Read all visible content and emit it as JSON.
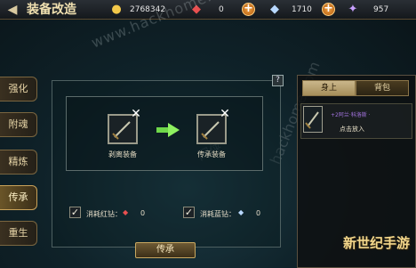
{
  "header": {
    "title": "装备改造",
    "gold": "2768342",
    "diamond_red": "0",
    "diamond_blue": "1710",
    "crystal": "957"
  },
  "side_tabs": [
    {
      "label": "强化",
      "active": false
    },
    {
      "label": "附魂",
      "active": false
    },
    {
      "label": "精炼",
      "active": false
    },
    {
      "label": "传承",
      "active": true
    },
    {
      "label": "重生",
      "active": false
    }
  ],
  "main": {
    "help_label": "?",
    "source_label": "剥离装备",
    "target_label": "传承装备",
    "options": [
      {
        "label": "消耗红钻：",
        "count": "0",
        "checked": true
      },
      {
        "label": "消耗蓝钻：",
        "count": "0",
        "checked": true
      }
    ],
    "inherit_button": "传承"
  },
  "right_panel": {
    "tabs": [
      "身上",
      "背包"
    ],
    "item": {
      "name": "+2阿兰·科洛斯 ·",
      "action": "点击放入"
    }
  },
  "watermarks": {
    "site": "www.hackhome.com",
    "site_small": "网侠",
    "site_bottom": "hackhome.com",
    "logo": "新世纪手游"
  },
  "colors": {
    "accent_gold": "#c8a860",
    "background": "#0f2229",
    "active_tab": "#6a5528",
    "item_name": "#a474e0"
  },
  "icons": [
    "back-arrow-icon",
    "gold-ingot-icon",
    "red-diamond-icon",
    "blue-diamond-icon",
    "crystal-icon",
    "plus-icon",
    "sword-icon",
    "close-x-icon",
    "green-arrow-icon",
    "checkmark-icon"
  ]
}
